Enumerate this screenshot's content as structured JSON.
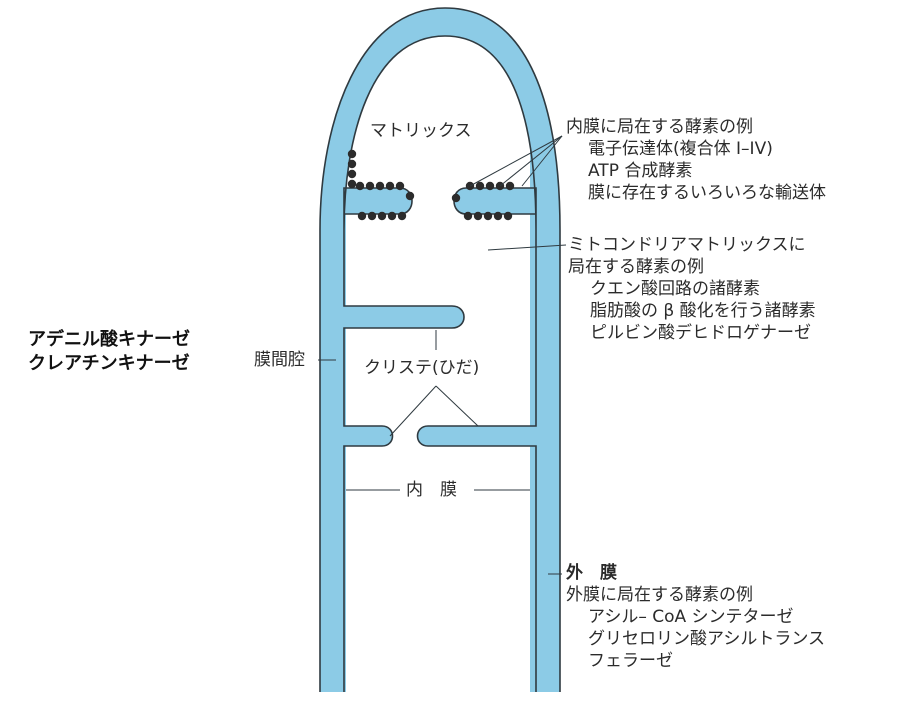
{
  "colors": {
    "membrane": "#8ccbe6",
    "outline": "#2f3a40",
    "particle": "#2c2c2c",
    "text": "#2b2b2b"
  },
  "labels": {
    "matrix": "マトリックス",
    "inner_enzymes": {
      "title": "内膜に局在する酵素の例",
      "items": [
        "電子伝達体(複合体 I–IV)",
        "ATP 合成酵素",
        "膜に存在するいろいろな輸送体"
      ]
    },
    "matrix_enzymes": {
      "title_line1": "ミトコンドリアマトリックスに",
      "title_line2": "局在する酵素の例",
      "items": [
        "クエン酸回路の諸酵素",
        "脂肪酸の β 酸化を行う諸酵素",
        "ピルビン酸デヒドロゲナーゼ"
      ]
    },
    "intermembrane_enzymes": [
      "アデニル酸キナーゼ",
      "クレアチンキナーゼ"
    ],
    "intermembrane_space": "膜間腔",
    "cristae": "クリステ(ひだ)",
    "inner_membrane": "内　膜",
    "outer_membrane": {
      "title": "外　膜",
      "subtitle": "外膜に局在する酵素の例",
      "items": [
        "アシル– CoA シンテターゼ",
        "グリセロリン酸アシルトランス",
        "フェラーゼ"
      ]
    }
  }
}
